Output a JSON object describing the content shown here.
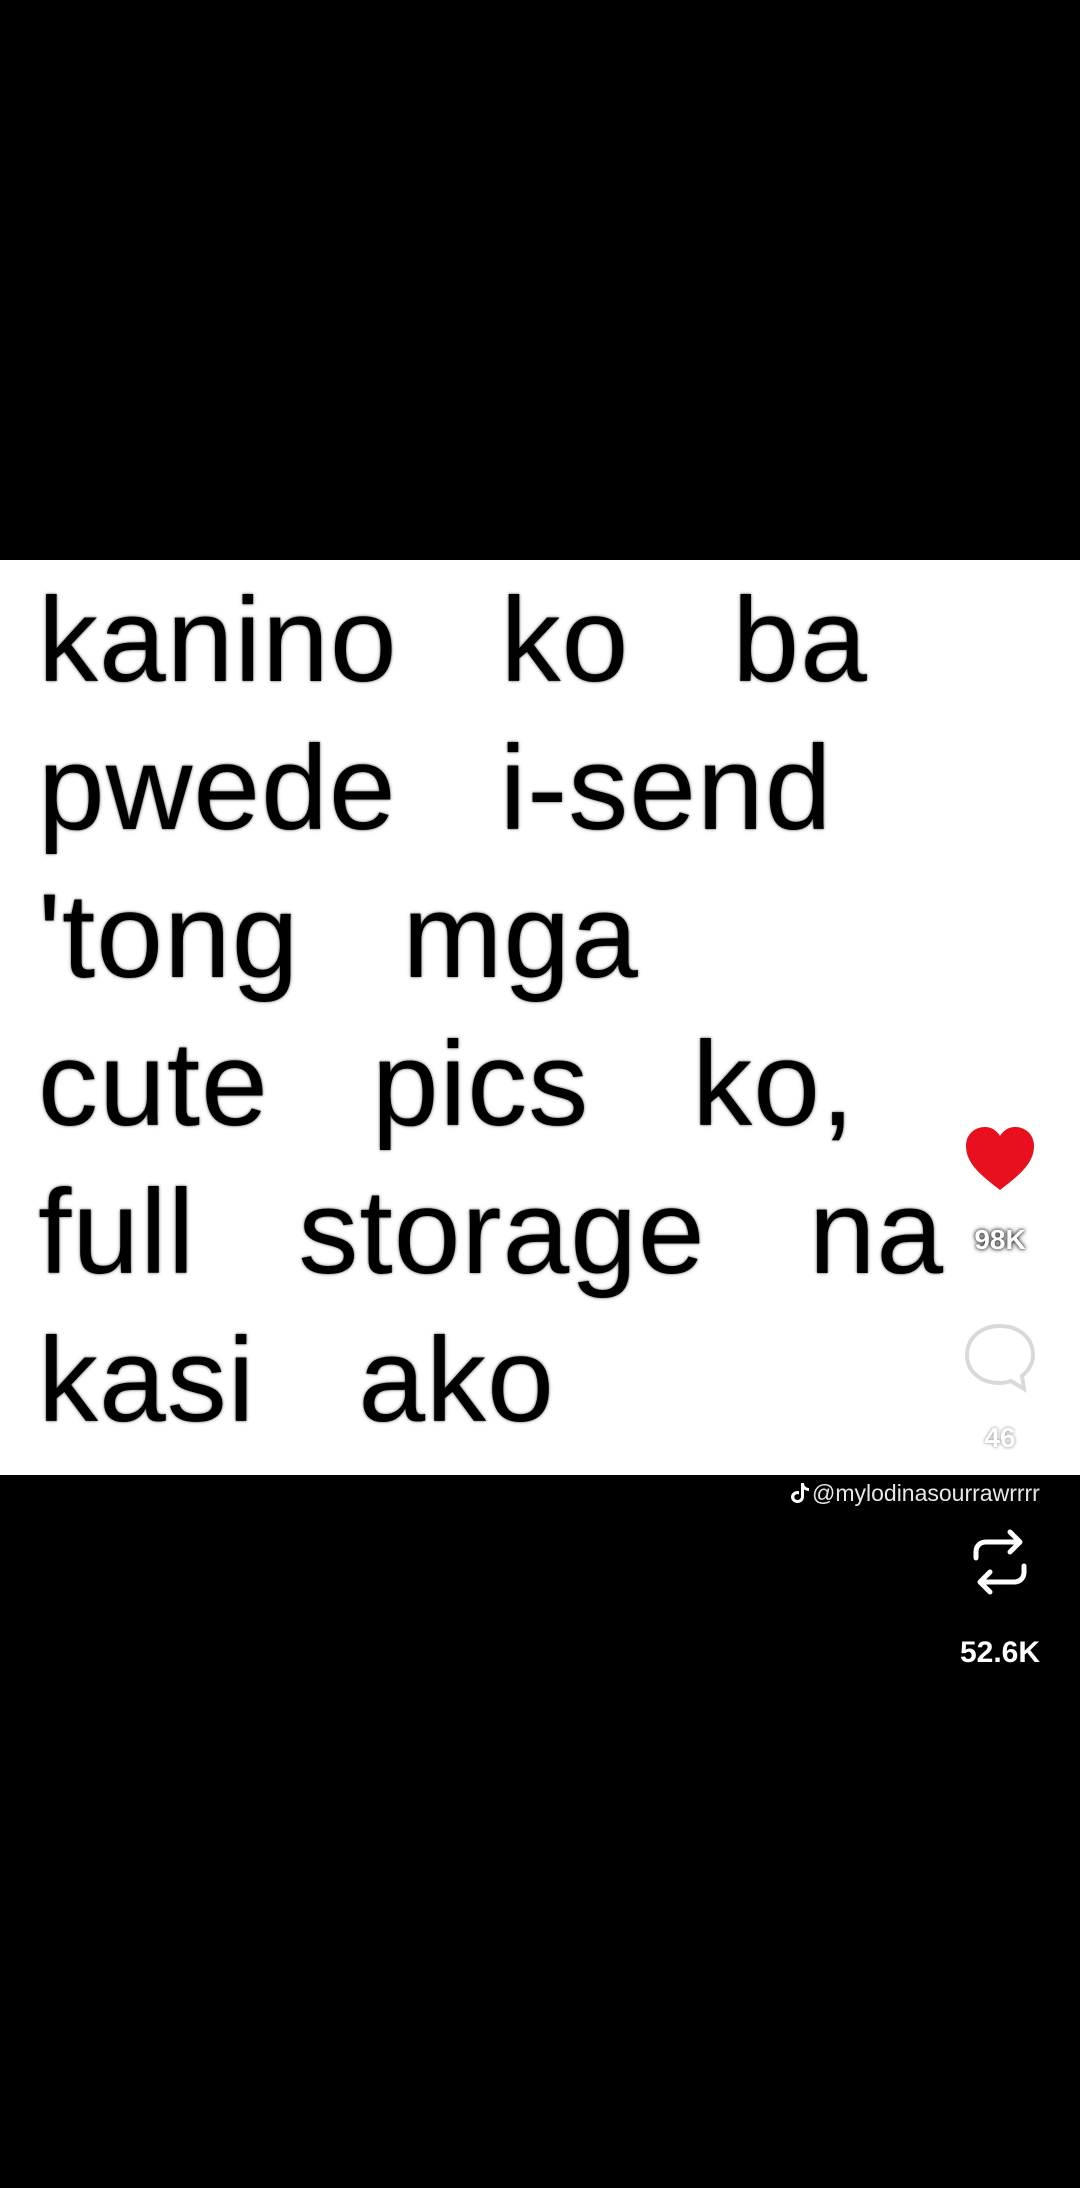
{
  "caption": {
    "lines": [
      "kanino   ko   ba",
      "pwede   i-send",
      "'tong   mga",
      "cute   pics   ko,",
      "full   storage   na",
      "kasi   ako"
    ]
  },
  "actions": {
    "like_count": "98K",
    "comment_count": "46",
    "repost_count": "52.6K"
  },
  "watermark": {
    "handle": "@mylodinasourrawrrrr"
  },
  "colors": {
    "heart": "#e8101e",
    "background": "#000000",
    "panel": "#ffffff"
  },
  "icons": {
    "like": "heart-icon",
    "comment": "comment-bubble-icon",
    "repost": "repost-icon",
    "brand": "tiktok-logo-icon"
  }
}
